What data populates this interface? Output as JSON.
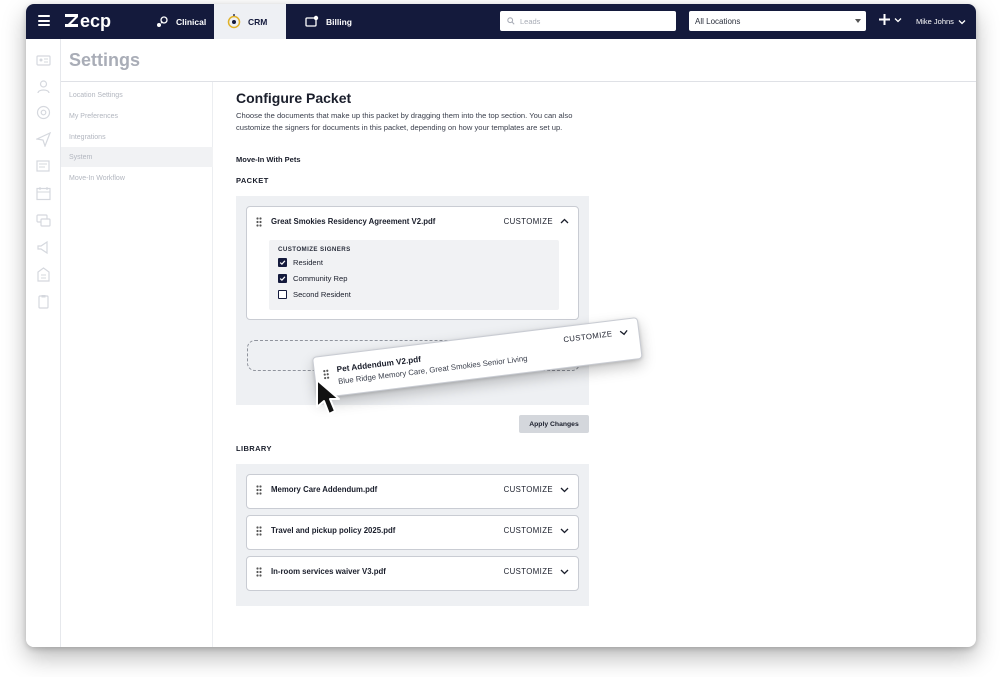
{
  "nav": {
    "logo_text": "ecp",
    "tabs": [
      {
        "label": "Clinical",
        "icon": "clinical-icon"
      },
      {
        "label": "CRM",
        "icon": "crm-icon",
        "active": true
      },
      {
        "label": "Billing",
        "icon": "billing-icon"
      }
    ],
    "search_placeholder": "Leads",
    "location_value": "All Locations",
    "user_name": "Mike Johns"
  },
  "rail_icons": [
    "id-card-icon",
    "person-icon",
    "at-icon",
    "send-icon",
    "list-icon",
    "calendar-icon",
    "chat-icon",
    "megaphone-icon",
    "building-icon",
    "clipboard-icon"
  ],
  "settings": {
    "title": "Settings",
    "menu": [
      "Location Settings",
      "My Preferences",
      "Integrations",
      "System",
      "Move-In Workflow"
    ],
    "active_index": 3
  },
  "main": {
    "title": "Configure Packet",
    "description": "Choose the documents that make up this packet by dragging them into the top section. You can also customize the signers for documents in this packet, depending on how your templates are set up.",
    "packet_name": "Move-In With Pets",
    "packet_label": "PACKET",
    "library_label": "LIBRARY",
    "customize_label": "CUSTOMIZE",
    "apply_label": "Apply Changes",
    "packet_doc": {
      "name": "Great Smokies Residency Agreement V2.pdf",
      "signers_label": "CUSTOMIZE SIGNERS",
      "signers": [
        {
          "label": "Resident",
          "checked": true
        },
        {
          "label": "Community Rep",
          "checked": true
        },
        {
          "label": "Second Resident",
          "checked": false
        }
      ]
    },
    "dragging_doc": {
      "name": "Pet Addendum V2.pdf",
      "subtitle": "Blue Ridge Memory Care, Great Smokies Senior Living"
    },
    "library_docs": [
      {
        "name": "Memory Care Addendum.pdf"
      },
      {
        "name": "Travel and pickup policy 2025.pdf"
      },
      {
        "name": "In-room services waiver V3.pdf"
      }
    ]
  },
  "colors": {
    "navy": "#141a3c",
    "zone_bg": "#eef0f3",
    "muted_text": "#a9adb7"
  }
}
